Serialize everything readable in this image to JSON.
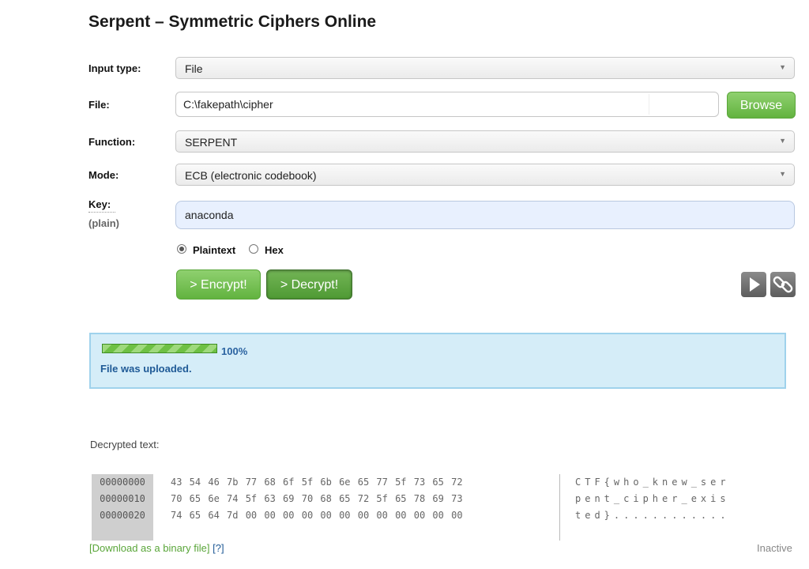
{
  "page": {
    "title": "Serpent – Symmetric Ciphers Online"
  },
  "form": {
    "input_type": {
      "label": "Input type:",
      "value": "File"
    },
    "file": {
      "label": "File:",
      "value": "C:\\fakepath\\cipher",
      "browse_label": "Browse"
    },
    "function": {
      "label": "Function:",
      "value": "SERPENT"
    },
    "mode": {
      "label": "Mode:",
      "value": "ECB (electronic codebook)"
    },
    "key": {
      "label": "Key:",
      "sublabel": "(plain)",
      "value": "anaconda"
    },
    "key_format": {
      "options": [
        "Plaintext",
        "Hex"
      ],
      "selected": "Plaintext"
    },
    "encrypt_label": "> Encrypt!",
    "decrypt_label": "> Decrypt!"
  },
  "status": {
    "progress_label": "100%",
    "progress": 1.0,
    "message": "File was uploaded."
  },
  "output": {
    "label": "Decrypted text:",
    "rows": [
      {
        "offset": "00000000",
        "hex": "43 54 46 7b 77 68 6f 5f 6b 6e 65 77 5f 73 65 72",
        "ascii": "CTF{who_knew_ser"
      },
      {
        "offset": "00000010",
        "hex": "70 65 6e 74 5f 63 69 70 68 65 72 5f 65 78 69 73",
        "ascii": "pent_cipher_exis"
      },
      {
        "offset": "00000020",
        "hex": "74 65 64 7d 00 00 00 00 00 00 00 00 00 00 00 00",
        "ascii": "ted}............"
      }
    ],
    "download_label": "[Download as a binary file]",
    "help_label": "[?]",
    "state": "Inactive"
  },
  "icons": {
    "play": "play-icon",
    "link": "link-icon"
  },
  "colors": {
    "green": "#62b33f",
    "status_bg": "#d5edf8",
    "status_border": "#9fd2ec",
    "status_text": "#1f5a96"
  }
}
